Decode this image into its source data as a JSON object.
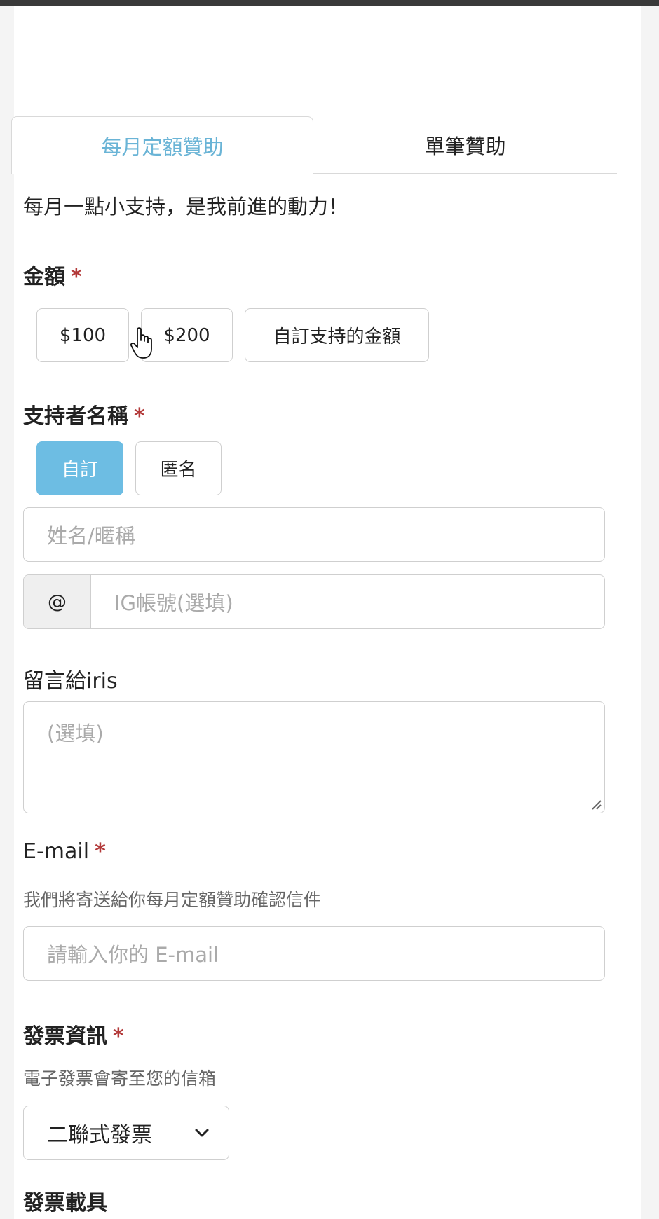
{
  "tabs": [
    {
      "label": "每月定額贊助",
      "active": true
    },
    {
      "label": "單筆贊助",
      "active": false
    }
  ],
  "intro": "每月一點小支持，是我前進的動力！",
  "amount": {
    "label": "金額",
    "required_mark": "*",
    "options": [
      "$100",
      "$200",
      "自訂支持的金額"
    ]
  },
  "supporter": {
    "label": "支持者名稱",
    "required_mark": "*",
    "options": [
      {
        "label": "自訂",
        "selected": true
      },
      {
        "label": "匿名",
        "selected": false
      }
    ],
    "name_placeholder": "姓名/暱稱",
    "ig_prefix": "@",
    "ig_placeholder": "IG帳號(選填)"
  },
  "message": {
    "label": "留言給iris",
    "placeholder": "(選填)"
  },
  "email": {
    "label": "E-mail",
    "required_mark": "*",
    "hint": "我們將寄送給你每月定額贊助確認信件",
    "placeholder": "請輸入你的 E-mail"
  },
  "invoice": {
    "label": "發票資訊",
    "required_mark": "*",
    "hint": "電子發票會寄至您的信箱",
    "selected": "二聯式發票"
  },
  "carrier": {
    "label": "發票載具"
  },
  "colors": {
    "accent": "#6dbde3",
    "tab_active_text": "#6ab4d6",
    "required": "#b33a3a"
  }
}
